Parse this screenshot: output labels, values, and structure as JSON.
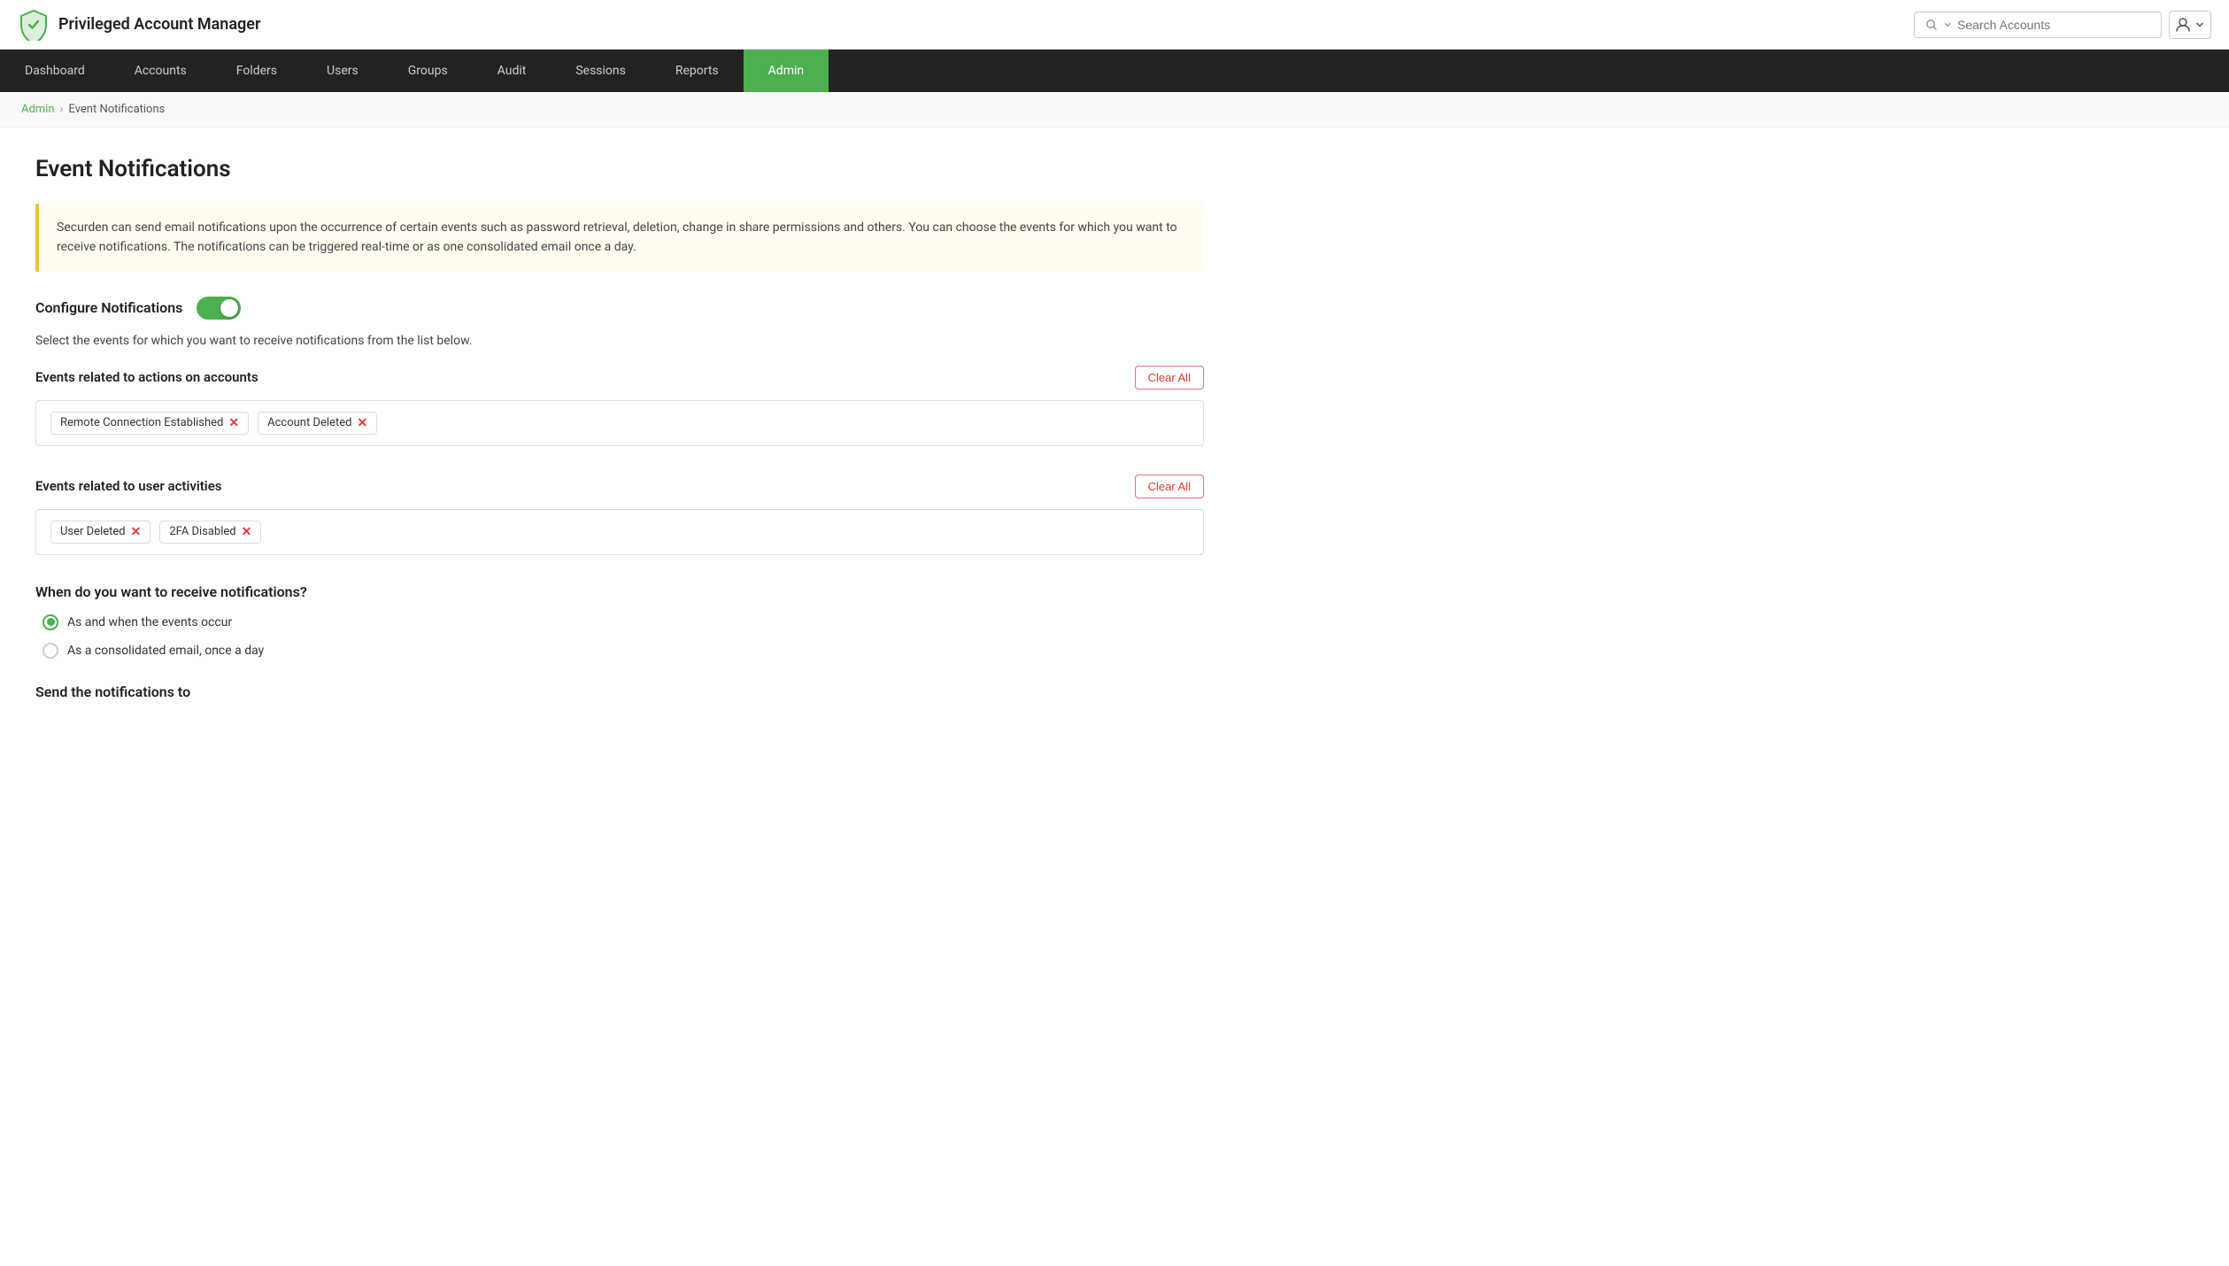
{
  "app": {
    "title": "Privileged Account Manager",
    "logo_alt": "Securden Logo"
  },
  "search": {
    "placeholder": "Search Accounts"
  },
  "nav": {
    "items": [
      {
        "label": "Dashboard",
        "active": false
      },
      {
        "label": "Accounts",
        "active": false
      },
      {
        "label": "Folders",
        "active": false
      },
      {
        "label": "Users",
        "active": false
      },
      {
        "label": "Groups",
        "active": false
      },
      {
        "label": "Audit",
        "active": false
      },
      {
        "label": "Sessions",
        "active": false
      },
      {
        "label": "Reports",
        "active": false
      },
      {
        "label": "Admin",
        "active": true
      }
    ]
  },
  "breadcrumb": {
    "parent": "Admin",
    "current": "Event Notifications"
  },
  "page": {
    "title": "Event Notifications",
    "info_text": "Securden can send email notifications upon the occurrence of certain events such as password retrieval, deletion, change in share permissions and others. You can choose the events for which you want to receive notifications. The notifications can be triggered real-time or as one consolidated email once a day.",
    "configure_label": "Configure Notifications",
    "select_events_text": "Select the events for which you want to receive notifications from the list below.",
    "accounts_section": {
      "title": "Events related to actions on accounts",
      "clear_all_label": "Clear All",
      "tags": [
        {
          "label": "Remote Connection Established"
        },
        {
          "label": "Account Deleted"
        }
      ]
    },
    "user_activities_section": {
      "title": "Events related to user activities",
      "clear_all_label": "Clear All",
      "tags": [
        {
          "label": "User Deleted"
        },
        {
          "label": "2FA Disabled"
        }
      ]
    },
    "when_section": {
      "title": "When do you want to receive notifications?",
      "options": [
        {
          "label": "As and when the events occur",
          "selected": true
        },
        {
          "label": "As a consolidated email, once a day",
          "selected": false
        }
      ]
    },
    "send_notifications_label": "Send the notifications to"
  }
}
